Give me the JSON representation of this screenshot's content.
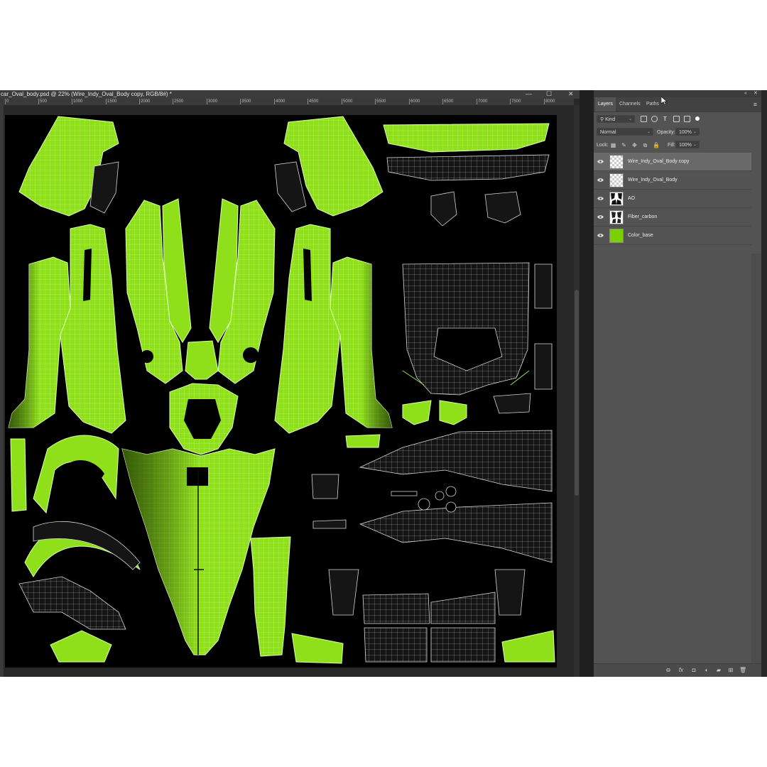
{
  "document": {
    "title": "car_Oval_body.psd @ 22% (Wire_Indy_Oval_Body copy, RGB/8#) *",
    "window_controls": [
      "—",
      "☐",
      "✕"
    ],
    "ruler_ticks": [
      "0",
      "500",
      "1000",
      "1500",
      "2000",
      "2500",
      "3000",
      "3500",
      "4000",
      "4500",
      "5000",
      "5500",
      "6000",
      "6500",
      "7000",
      "7500",
      "8000"
    ]
  },
  "panel": {
    "tabs": [
      "Layers",
      "Channels",
      "Paths"
    ],
    "active_tab": "Layers",
    "filter_kind": "Kind",
    "blend_mode": "Normal",
    "opacity_label": "Opacity:",
    "opacity_value": "100%",
    "lock_label": "Lock:",
    "fill_label": "Fill:",
    "fill_value": "100%",
    "layers": [
      {
        "name": "Wire_Indy_Oval_Body copy",
        "thumb": "checker",
        "visible": true,
        "selected": true
      },
      {
        "name": "Wire_Indy_Oval_Body",
        "thumb": "checker",
        "visible": true,
        "selected": false
      },
      {
        "name": "AO",
        "thumb": "ao",
        "visible": true,
        "selected": false
      },
      {
        "name": "Fiber_carbon",
        "thumb": "fiber",
        "visible": true,
        "selected": false
      },
      {
        "name": "Color_base",
        "thumb": "color",
        "visible": true,
        "selected": false
      }
    ],
    "footer_icons": [
      "link-icon",
      "fx-icon",
      "mask-icon",
      "adjustment-icon",
      "group-folder-icon",
      "new-layer-icon",
      "trash-icon"
    ],
    "footer_glyphs": [
      "⊖",
      "fx",
      "◘",
      "◐",
      "▰",
      "⊞",
      "🗑"
    ]
  },
  "colors": {
    "uv_green": "#8fe01a",
    "wire": "#e8ffd8",
    "canvas_bg": "#000000",
    "panel_bg": "#535353",
    "selected_row": "#6a6a6a"
  }
}
